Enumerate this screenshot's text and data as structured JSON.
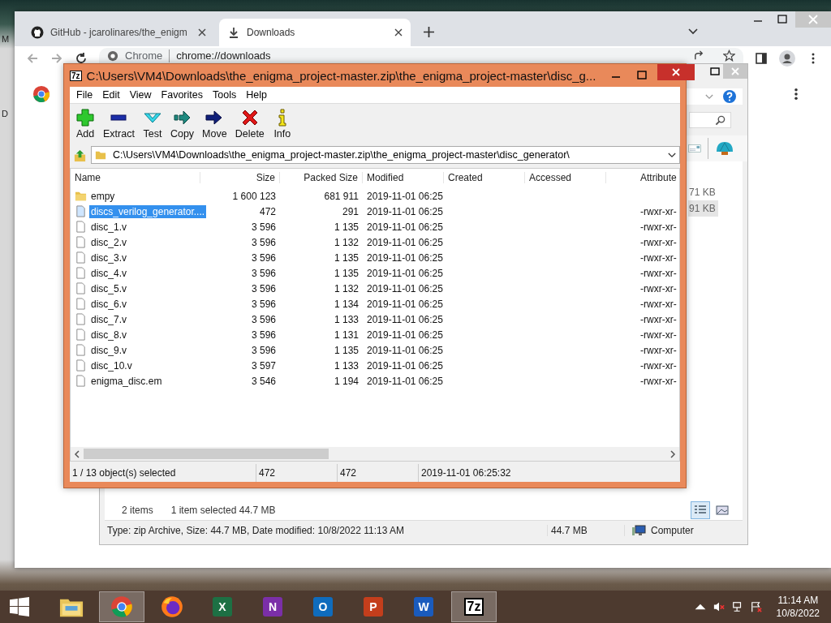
{
  "desktop_labels": [
    "M",
    "D"
  ],
  "chrome": {
    "tabs": [
      {
        "title": "GitHub - jcarolinares/the_enigm",
        "kind": "github",
        "selected": false
      },
      {
        "title": "Downloads",
        "kind": "download",
        "selected": true
      }
    ],
    "omnibox": {
      "chip": "Chrome",
      "url": "chrome://downloads"
    }
  },
  "explorer": {
    "rows": [
      {
        "size": "71 KB",
        "selected": false
      },
      {
        "size": "91 KB",
        "selected": true
      }
    ],
    "item_count": "2 items",
    "selection": "1 item selected  44.7 MB",
    "status": "Type: zip Archive, Size: 44.7 MB, Date modified: 10/8/2022 11:13 AM",
    "status_size": "44.7 MB",
    "status_location": "Computer"
  },
  "sevenzip": {
    "title": "C:\\Users\\VM4\\Downloads\\the_enigma_project-master.zip\\the_enigma_project-master\\disc_g...",
    "app_badge": "7z",
    "menu": [
      "File",
      "Edit",
      "View",
      "Favorites",
      "Tools",
      "Help"
    ],
    "toolbar": [
      {
        "label": "Add",
        "kind": "add"
      },
      {
        "label": "Extract",
        "kind": "extract"
      },
      {
        "label": "Test",
        "kind": "test"
      },
      {
        "label": "Copy",
        "kind": "copy"
      },
      {
        "label": "Move",
        "kind": "move"
      },
      {
        "label": "Delete",
        "kind": "delete"
      },
      {
        "label": "Info",
        "kind": "info"
      }
    ],
    "path": "C:\\Users\\VM4\\Downloads\\the_enigma_project-master.zip\\the_enigma_project-master\\disc_generator\\",
    "columns": [
      "Name",
      "Size",
      "Packed Size",
      "Modified",
      "Created",
      "Accessed",
      "Attribute"
    ],
    "rows": [
      {
        "kind": "folder",
        "name": "empy",
        "size": "1 600 123",
        "packed": "681 911",
        "modified": "2019-11-01 06:25",
        "attributes": "",
        "selected": false
      },
      {
        "kind": "file",
        "name": "discs_verilog_generator....",
        "size": "472",
        "packed": "291",
        "modified": "2019-11-01 06:25",
        "attributes": "-rwxr-xr-",
        "selected": true
      },
      {
        "kind": "file",
        "name": "disc_1.v",
        "size": "3 596",
        "packed": "1 135",
        "modified": "2019-11-01 06:25",
        "attributes": "-rwxr-xr-",
        "selected": false
      },
      {
        "kind": "file",
        "name": "disc_2.v",
        "size": "3 596",
        "packed": "1 132",
        "modified": "2019-11-01 06:25",
        "attributes": "-rwxr-xr-",
        "selected": false
      },
      {
        "kind": "file",
        "name": "disc_3.v",
        "size": "3 596",
        "packed": "1 135",
        "modified": "2019-11-01 06:25",
        "attributes": "-rwxr-xr-",
        "selected": false
      },
      {
        "kind": "file",
        "name": "disc_4.v",
        "size": "3 596",
        "packed": "1 135",
        "modified": "2019-11-01 06:25",
        "attributes": "-rwxr-xr-",
        "selected": false
      },
      {
        "kind": "file",
        "name": "disc_5.v",
        "size": "3 596",
        "packed": "1 132",
        "modified": "2019-11-01 06:25",
        "attributes": "-rwxr-xr-",
        "selected": false
      },
      {
        "kind": "file",
        "name": "disc_6.v",
        "size": "3 596",
        "packed": "1 134",
        "modified": "2019-11-01 06:25",
        "attributes": "-rwxr-xr-",
        "selected": false
      },
      {
        "kind": "file",
        "name": "disc_7.v",
        "size": "3 596",
        "packed": "1 133",
        "modified": "2019-11-01 06:25",
        "attributes": "-rwxr-xr-",
        "selected": false
      },
      {
        "kind": "file",
        "name": "disc_8.v",
        "size": "3 596",
        "packed": "1 131",
        "modified": "2019-11-01 06:25",
        "attributes": "-rwxr-xr-",
        "selected": false
      },
      {
        "kind": "file",
        "name": "disc_9.v",
        "size": "3 596",
        "packed": "1 135",
        "modified": "2019-11-01 06:25",
        "attributes": "-rwxr-xr-",
        "selected": false
      },
      {
        "kind": "file",
        "name": "disc_10.v",
        "size": "3 597",
        "packed": "1 133",
        "modified": "2019-11-01 06:25",
        "attributes": "-rwxr-xr-",
        "selected": false
      },
      {
        "kind": "file",
        "name": "enigma_disc.em",
        "size": "3 546",
        "packed": "1 194",
        "modified": "2019-11-01 06:25",
        "attributes": "-rwxr-xr-",
        "selected": false
      }
    ],
    "status": [
      "1 / 13 object(s) selected",
      "472",
      "472",
      "2019-11-01 06:25:32"
    ]
  },
  "taskbar": {
    "apps": [
      {
        "kind": "explorer",
        "active": false
      },
      {
        "kind": "chrome",
        "active": true
      },
      {
        "kind": "firefox",
        "active": false
      },
      {
        "kind": "office",
        "letter": "X",
        "color": "#1d7044",
        "active": false
      },
      {
        "kind": "office",
        "letter": "N",
        "color": "#7b2fa8",
        "active": false
      },
      {
        "kind": "office",
        "letter": "O",
        "color": "#0f6cbd",
        "active": false
      },
      {
        "kind": "office",
        "letter": "P",
        "color": "#c43e1c",
        "active": false
      },
      {
        "kind": "office",
        "letter": "W",
        "color": "#1a5bbd",
        "active": false
      },
      {
        "kind": "sevenzip",
        "badge": "7z",
        "active": true
      }
    ],
    "time": "11:14 AM",
    "date": "10/8/2022"
  }
}
